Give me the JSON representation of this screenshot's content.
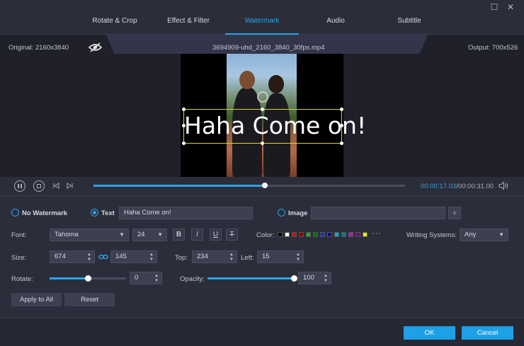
{
  "tabs": [
    {
      "label": "Rotate & Crop"
    },
    {
      "label": "Effect & Filter"
    },
    {
      "label": "Watermark",
      "active": true
    },
    {
      "label": "Audio"
    },
    {
      "label": "Subtitle"
    }
  ],
  "info": {
    "original": "Original: 2160x3840",
    "filename": "3694909-uhd_2160_3840_30fps.mp4",
    "output": "Output: 700x526"
  },
  "watermark_preview_text": "Haha Come on!",
  "playback": {
    "current_time": "00:00:17.03",
    "total_time": "/00:00:31.00",
    "progress": 0.55
  },
  "watermark": {
    "no_watermark_label": "No Watermark",
    "text_label": "Text",
    "text_value": "Haha Come on!",
    "image_label": "Image",
    "image_value": "",
    "selected": "text"
  },
  "font": {
    "label": "Font:",
    "family": "Tahoma",
    "size": "24",
    "bold": "B",
    "italic": "I",
    "underline": "U",
    "strike": "T"
  },
  "color": {
    "label": "Color:",
    "swatches": [
      "#000000",
      "#ffffff",
      "#cc1111",
      "#880000",
      "#22aa22",
      "#116611",
      "#1133cc",
      "#111177",
      "#11aacc",
      "#117788",
      "#aa22aa",
      "#661166",
      "#eeee11"
    ],
    "more": "···"
  },
  "writing_systems": {
    "label": "Writing Systems:",
    "value": "Any"
  },
  "size": {
    "label": "Size:",
    "width": "674",
    "height": "145"
  },
  "position": {
    "top_label": "Top:",
    "top": "234",
    "left_label": "Left:",
    "left": "15"
  },
  "rotate": {
    "label": "Rotate:",
    "value": "0",
    "level": 0.5
  },
  "opacity": {
    "label": "Opacity:",
    "value": "100",
    "level": 1.0
  },
  "buttons": {
    "apply_all": "Apply to All",
    "reset": "Reset",
    "ok": "OK",
    "cancel": "Cancel"
  },
  "colors": {
    "accent": "#29a4e6",
    "background": "#2b2d3a",
    "panel": "#1f2029"
  }
}
